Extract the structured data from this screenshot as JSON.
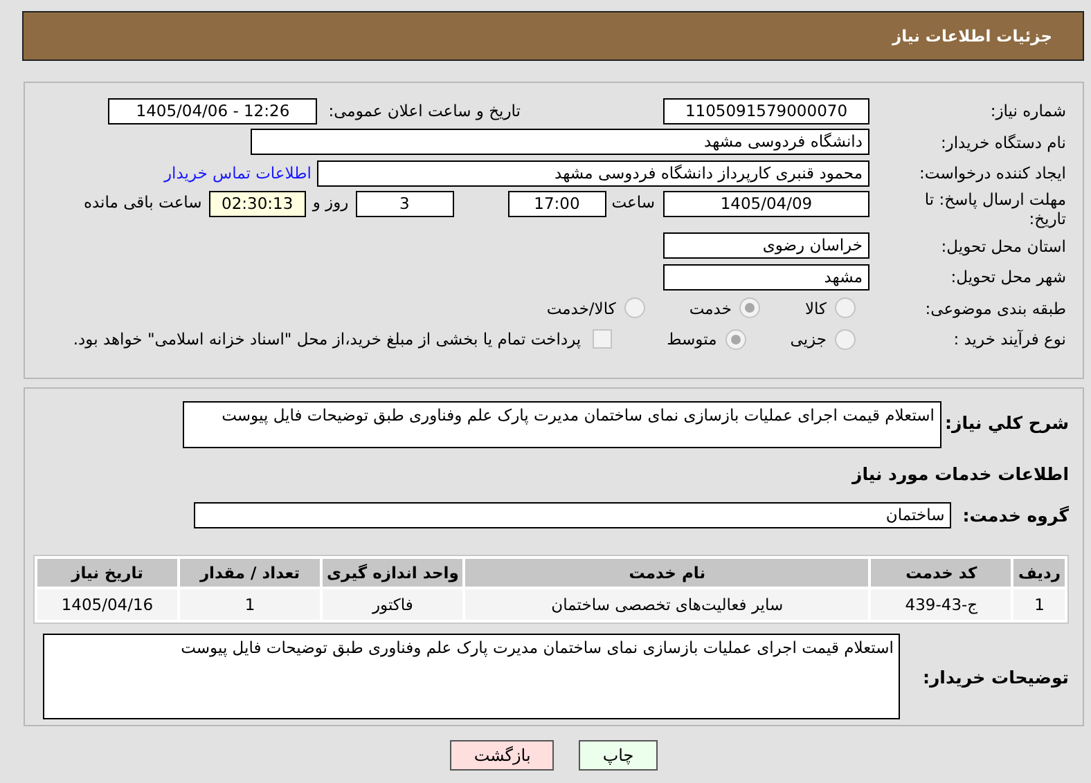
{
  "header": {
    "title": "جزئیات اطلاعات نیاز"
  },
  "need_number": {
    "label": "شماره نیاز:",
    "value": "1105091579000070"
  },
  "announce_datetime": {
    "label": "تاریخ و ساعت اعلان عمومی:",
    "value": "1405/04/06 - 12:26"
  },
  "buyer_org": {
    "label": "نام دستگاه خریدار:",
    "value": "دانشگاه فردوسی مشهد"
  },
  "requester": {
    "label": "ایجاد کننده درخواست:",
    "value": "محمود قنبری کارپرداز دانشگاه فردوسی مشهد",
    "link": "اطلاعات تماس خریدار"
  },
  "deadline": {
    "label": "مهلت ارسال پاسخ: تا تاریخ:",
    "date": "1405/04/09",
    "time_label": "ساعت",
    "time": "17:00",
    "days": "3",
    "days_label": "روز و",
    "remaining": "02:30:13",
    "remaining_label": "ساعت باقی مانده"
  },
  "province": {
    "label": "استان محل تحویل:",
    "value": "خراسان رضوی"
  },
  "city": {
    "label": "شهر محل تحویل:",
    "value": "مشهد"
  },
  "category": {
    "label": "طبقه بندی موضوعی:",
    "options": [
      {
        "label": "کالا",
        "selected": false
      },
      {
        "label": "خدمت",
        "selected": true
      },
      {
        "label": "کالا/خدمت",
        "selected": false
      }
    ]
  },
  "process": {
    "label": "نوع فرآیند خرید :",
    "options": [
      {
        "label": "جزیی",
        "selected": false
      },
      {
        "label": "متوسط",
        "selected": true
      }
    ],
    "payment": {
      "checked": false,
      "text": "پرداخت تمام یا بخشی از مبلغ خرید،از محل \"اسناد خزانه اسلامی\" خواهد بود."
    }
  },
  "description": {
    "label": "شرح کلي نیاز:",
    "value": "استعلام قیمت اجرای عملیات بازسازی نمای ساختمان مدیرت پارک علم وفناوری طبق توضیحات فایل پیوست"
  },
  "services_heading": "اطلاعات خدمات مورد نیاز",
  "service_group": {
    "label": "گروه خدمت:",
    "value": "ساختمان"
  },
  "table": {
    "columns": [
      "ردیف",
      "کد خدمت",
      "نام خدمت",
      "واحد اندازه گیری",
      "تعداد / مقدار",
      "تاریخ نیاز"
    ],
    "rows": [
      [
        "1",
        "ج-43-439",
        "سایر فعالیت‌های تخصصی ساختمان",
        "فاکتور",
        "1",
        "1405/04/16"
      ]
    ]
  },
  "buyer_notes": {
    "label": "توضیحات خریدار:",
    "value": "استعلام قیمت اجرای عملیات بازسازی نمای ساختمان مدیرت پارک علم وفناوری طبق توضیحات فایل پیوست"
  },
  "buttons": [
    {
      "label": "چاپ",
      "kind": "print"
    },
    {
      "label": "بازگشت",
      "kind": "back"
    }
  ]
}
